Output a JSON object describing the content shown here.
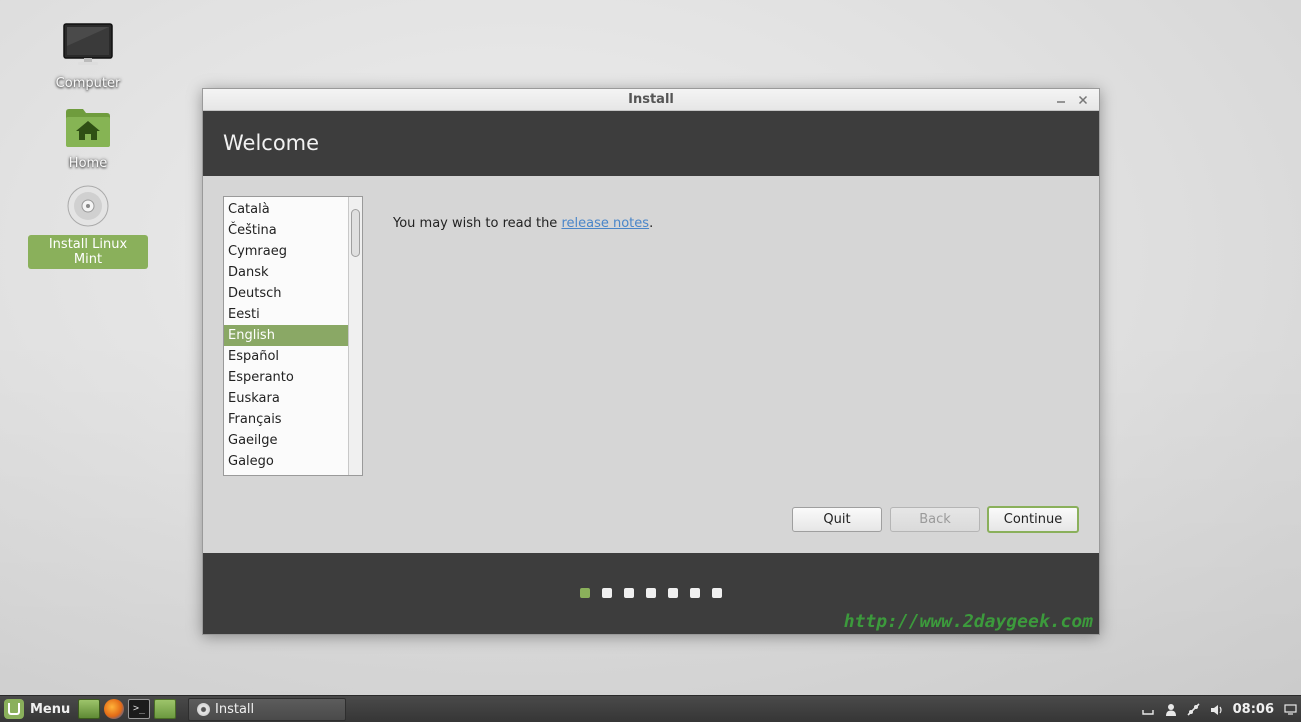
{
  "desktop": {
    "icons": [
      {
        "label": "Computer",
        "icon": "monitor-icon"
      },
      {
        "label": "Home",
        "icon": "home-folder-icon"
      },
      {
        "label": "Install Linux Mint",
        "icon": "cd-icon"
      }
    ]
  },
  "window": {
    "title": "Install",
    "header": "Welcome",
    "languages": [
      "Català",
      "Čeština",
      "Cymraeg",
      "Dansk",
      "Deutsch",
      "Eesti",
      "English",
      "Español",
      "Esperanto",
      "Euskara",
      "Français",
      "Gaeilge",
      "Galego"
    ],
    "selected_language": "English",
    "release_prefix": "You may wish to read the ",
    "release_link": "release notes",
    "release_suffix": ".",
    "buttons": {
      "quit": "Quit",
      "back": "Back",
      "continue": "Continue"
    },
    "progress": {
      "current_step": 1,
      "total_steps": 7
    },
    "watermark": "http://www.2daygeek.com"
  },
  "taskbar": {
    "menu_label": "Menu",
    "window_button": "Install",
    "clock": "08:06"
  },
  "colors": {
    "accent": "#8ab05b",
    "header_bg": "#3d3d3d",
    "link": "#4a86c9"
  }
}
